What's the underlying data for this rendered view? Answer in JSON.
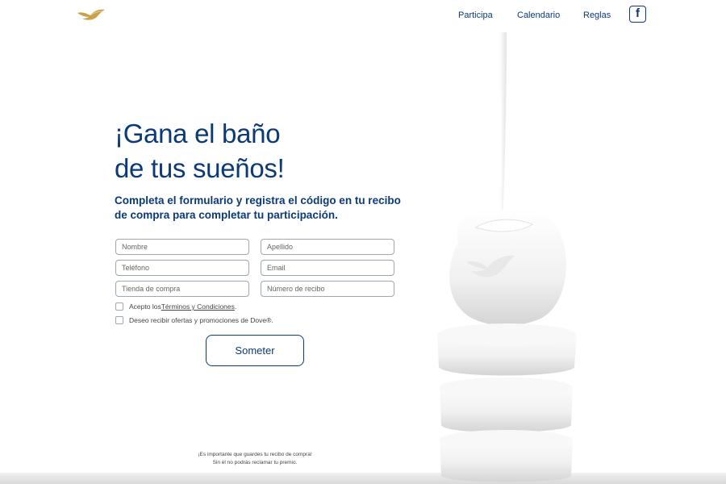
{
  "header": {
    "logo_icon": "dove-logo-icon",
    "nav": [
      "Participa",
      "Calendario",
      "Reglas"
    ],
    "facebook_icon": "facebook-icon",
    "facebook_glyph": "f"
  },
  "hero": {
    "headline_line1": "¡Gana el baño",
    "headline_line2": "de tus sueños!",
    "subtitle": "Completa el formulario y registra el código en tu recibo de compra para completar tu participación."
  },
  "form": {
    "fields": [
      {
        "placeholder": "Nombre",
        "value": ""
      },
      {
        "placeholder": "Apellido",
        "value": ""
      },
      {
        "placeholder": "Teléfono",
        "value": ""
      },
      {
        "placeholder": "Email",
        "value": ""
      },
      {
        "placeholder": "Tienda de compra",
        "value": ""
      },
      {
        "placeholder": "Número de recibo",
        "value": ""
      }
    ],
    "terms_prefix": "Acepto los ",
    "terms_link": "Términos y Condiciones",
    "terms_suffix": ".",
    "offers_label": "Deseo recibir ofertas y promociones de Dove®.",
    "submit_label": "Someter"
  },
  "footer_note": {
    "line1": "¡Es importante que guardes tu recibo de compra!",
    "line2": "Sin él no podrás reclamar tu premio."
  },
  "colors": {
    "brand_blue": "#0b3a78",
    "gold": "#c9a24a"
  }
}
